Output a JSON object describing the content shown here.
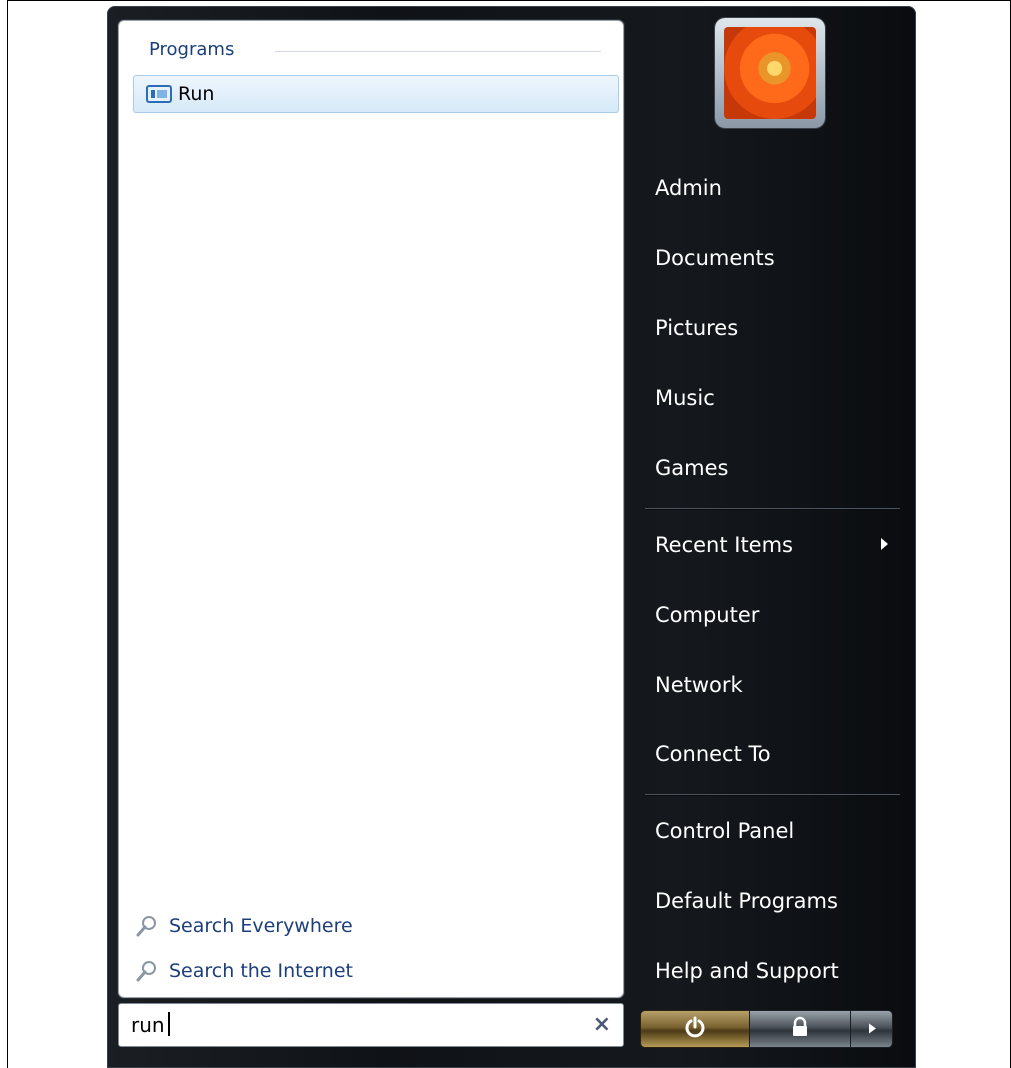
{
  "left_pane": {
    "programs_header": "Programs",
    "results": [
      {
        "label": "Run",
        "icon": "run-icon"
      }
    ],
    "search_links": [
      {
        "label": "Search Everywhere",
        "icon": "search-icon"
      },
      {
        "label": "Search the Internet",
        "icon": "search-icon"
      }
    ]
  },
  "search": {
    "value": "run",
    "clear_symbol": "×"
  },
  "user": {
    "avatar": "flower-avatar"
  },
  "right_pane": {
    "items": [
      {
        "label": "Admin"
      },
      {
        "label": "Documents"
      },
      {
        "label": "Pictures"
      },
      {
        "label": "Music"
      },
      {
        "label": "Games"
      },
      {
        "label": "Recent Items",
        "submenu": true
      },
      {
        "label": "Computer"
      },
      {
        "label": "Network"
      },
      {
        "label": "Connect To"
      },
      {
        "label": "Control Panel"
      },
      {
        "label": "Default Programs"
      },
      {
        "label": "Help and Support"
      }
    ]
  },
  "power_buttons": {
    "power": "power-icon",
    "lock": "lock-icon",
    "more": "arrow-right-icon"
  },
  "colors": {
    "link_blue": "#1b3f7a",
    "menu_dark": "#0f1216",
    "highlight": "#d6e9f8"
  }
}
